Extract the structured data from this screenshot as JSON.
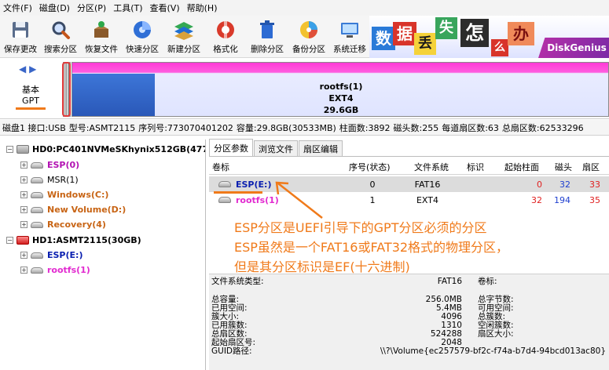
{
  "menu": [
    "文件(F)",
    "磁盘(D)",
    "分区(P)",
    "工具(T)",
    "查看(V)",
    "帮助(H)"
  ],
  "toolbar": {
    "buttons": [
      {
        "label": "保存更改",
        "icon": "save-icon"
      },
      {
        "label": "搜索分区",
        "icon": "search-icon"
      },
      {
        "label": "恢复文件",
        "icon": "recover-icon"
      },
      {
        "label": "快速分区",
        "icon": "quick-partition-icon"
      },
      {
        "label": "新建分区",
        "icon": "new-partition-icon"
      },
      {
        "label": "格式化",
        "icon": "format-icon"
      },
      {
        "label": "删除分区",
        "icon": "delete-icon"
      },
      {
        "label": "备份分区",
        "icon": "backup-icon"
      },
      {
        "label": "系统迁移",
        "icon": "migrate-icon"
      }
    ]
  },
  "banner": {
    "chars": [
      "数",
      "据",
      "丢",
      "失",
      "怎",
      "么",
      "办"
    ],
    "brand": "DiskGenius"
  },
  "disk_nav": {
    "type": "基本",
    "style": "GPT"
  },
  "partition_strip": {
    "name": "rootfs(1)",
    "fs": "EXT4",
    "size": "29.6GB"
  },
  "infobar": [
    "磁盘1 接口:USB",
    "型号:ASMT2115",
    "序列号:773070401202",
    "容量:29.8GB(30533MB)",
    "柱面数:3892",
    "磁头数:255",
    "每道扇区数:63",
    "总扇区数:62533296"
  ],
  "tree": [
    {
      "label": "HD0:PC401NVMeSKhynix512GB(477G",
      "kind": "disk",
      "style": "bold",
      "exp": "-"
    },
    {
      "label": "ESP(0)",
      "kind": "part",
      "style": "c-esp",
      "exp": "+"
    },
    {
      "label": "MSR(1)",
      "kind": "part",
      "style": "c-msr",
      "exp": "+"
    },
    {
      "label": "Windows(C:)",
      "kind": "part",
      "style": "c-win",
      "exp": "+"
    },
    {
      "label": "New Volume(D:)",
      "kind": "part",
      "style": "c-win",
      "exp": "+"
    },
    {
      "label": "Recovery(4)",
      "kind": "part",
      "style": "c-win",
      "exp": "+"
    },
    {
      "label": "HD1:ASMT2115(30GB)",
      "kind": "disk-red",
      "style": "bold",
      "exp": "-"
    },
    {
      "label": "ESP(E:)",
      "kind": "part",
      "style": "c-blue",
      "exp": "+"
    },
    {
      "label": "rootfs(1)",
      "kind": "part",
      "style": "c-pink",
      "exp": "+"
    }
  ],
  "tabs": [
    "分区参数",
    "浏览文件",
    "扇区编辑"
  ],
  "grid": {
    "headers": [
      "卷标",
      "序号(状态)",
      "文件系统",
      "标识",
      "起始柱面",
      "磁头",
      "扇区"
    ],
    "rows": [
      {
        "label": "ESP(E:)",
        "index": "0",
        "fs": "FAT16",
        "flag": "",
        "start_cyl": "0",
        "head": "32",
        "sector": "33",
        "style": "c-blue"
      },
      {
        "label": "rootfs(1)",
        "index": "1",
        "fs": "EXT4",
        "flag": "",
        "start_cyl": "32",
        "head": "194",
        "sector": "35",
        "style": "c-pink"
      }
    ]
  },
  "details": {
    "fs_type_label": "文件系统类型:",
    "fs_type_value": "FAT16",
    "volume_label": "卷标:",
    "rows": [
      {
        "label": "总容量:",
        "value": "256.0MB",
        "label2": "总字节数:"
      },
      {
        "label": "已用空间:",
        "value": "5.4MB",
        "label2": "可用空间:"
      },
      {
        "label": "簇大小:",
        "value": "4096",
        "label2": "总簇数:"
      },
      {
        "label": "已用簇数:",
        "value": "1310",
        "label2": "空闲簇数:"
      },
      {
        "label": "总扇区数:",
        "value": "524288",
        "label2": "扇区大小:"
      },
      {
        "label": "起始扇区号:",
        "value": "2048",
        "label2": ""
      }
    ],
    "guid_label": "GUID路径:",
    "guid_value": "\\\\?\\Volume{ec257579-bf2c-f74a-b7d4-94bcd013ac80}"
  },
  "annotation": {
    "lines": [
      "ESP分区是UEFI引导下的GPT分区必须的分区",
      "ESP虽然是一个FAT16或FAT32格式的物理分区，",
      "但是其分区标识是EF(十六进制)"
    ]
  },
  "colors": {
    "annotation": "#f07a1a",
    "esp_blue": "#0a1fb0",
    "pink": "#e22bd0",
    "orange": "#c86414",
    "partition_magenta": "#ff3bd6"
  }
}
